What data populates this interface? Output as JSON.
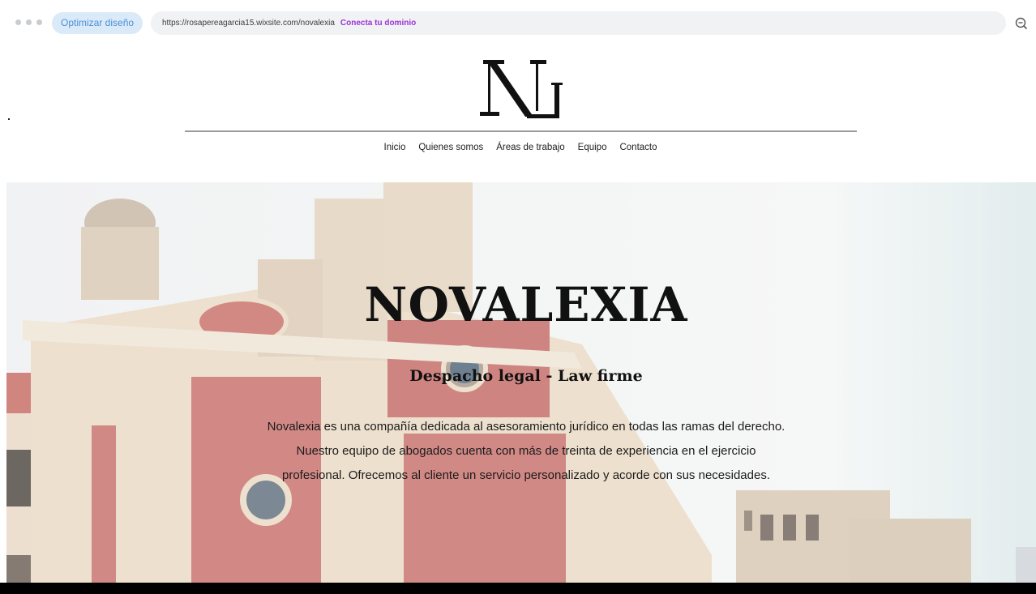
{
  "browser": {
    "optimize_label": "Optimizar diseño",
    "url": "https://rosapereagarcia15.wixsite.com/novalexia",
    "connect_domain": "Conecta tu dominio",
    "zoom_icon": "zoom-out-icon"
  },
  "header": {
    "logo_text": "NL",
    "nav": [
      "Inicio",
      "Quienes somos",
      "Áreas de trabajo",
      "Equipo",
      "Contacto"
    ]
  },
  "hero": {
    "title": "NOVALEXIA",
    "subtitle": "Despacho legal - Law firme",
    "lines": [
      "Novalexia es una compañía dedicada al asesoramiento jurídico en todas las ramas del derecho.",
      "Nuestro equipo de abogados cuenta con más de treinta de experiencia en el ejercicio",
      "profesional. Ofrecemos al cliente un servicio personalizado y acorde con sus necesidades."
    ]
  },
  "colors": {
    "accent_pill": "#dbeaf8",
    "connect_link": "#9b35d6",
    "brick": "#c9706c",
    "stone": "#e6d9c7"
  }
}
